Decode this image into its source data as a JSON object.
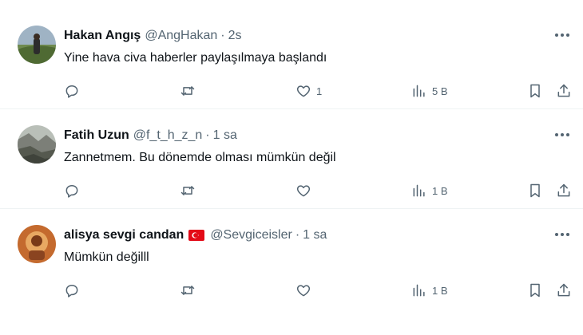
{
  "tweets": [
    {
      "name": "Hakan Angış",
      "handle": "@AngHakan",
      "separator": "·",
      "time": "2s",
      "text": "Yine hava civa haberler paylaşılmaya başlandı",
      "reply_count": "",
      "retweet_count": "",
      "like_count": "1",
      "view_count": "5 B",
      "avatar_colors": [
        "#8a9a6a",
        "#3d4a2e"
      ],
      "flag": false
    },
    {
      "name": "Fatih Uzun",
      "handle": "@f_t_h_z_n",
      "separator": "·",
      "time": "1 sa",
      "text": "Zannetmem. Bu dönemde olması mümkün değil",
      "reply_count": "",
      "retweet_count": "",
      "like_count": "",
      "view_count": "1 B",
      "avatar_colors": [
        "#7a7e78",
        "#c9cbc4"
      ],
      "flag": false
    },
    {
      "name": "alisya sevgi candan",
      "handle": "@Sevgiceisler",
      "separator": "·",
      "time": "1 sa",
      "text": "Mümkün değilll",
      "reply_count": "",
      "retweet_count": "",
      "like_count": "",
      "view_count": "1 B",
      "avatar_colors": [
        "#b05a2a",
        "#e6a25a"
      ],
      "flag": true
    }
  ],
  "icons": {
    "reply": "reply-icon",
    "retweet": "retweet-icon",
    "like": "heart-icon",
    "views": "views-bar-chart-icon",
    "bookmark": "bookmark-icon",
    "share": "share-icon",
    "more": "more-dots-icon",
    "flag": "turkey-flag-icon"
  },
  "colors": {
    "text": "#0f1419",
    "secondary": "#536471",
    "divider": "#eff3f4",
    "flag_red": "#e30a17"
  }
}
